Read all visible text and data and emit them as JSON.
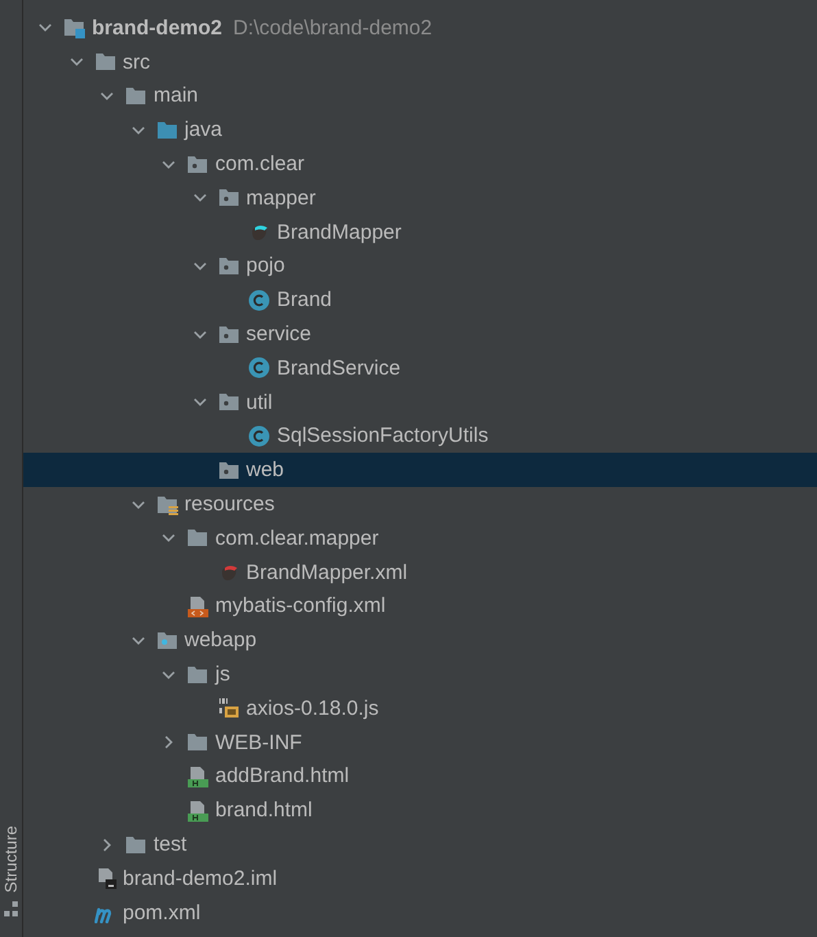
{
  "side_panel": {
    "tab": "Structure"
  },
  "tree": [
    {
      "label": "brand-demo2",
      "path": "D:\\code\\brand-demo2",
      "kind": "project",
      "expanded": true,
      "selected": false,
      "children": [
        {
          "label": "src",
          "kind": "folder",
          "expanded": true,
          "selected": false,
          "children": [
            {
              "label": "main",
              "kind": "folder",
              "expanded": true,
              "selected": false,
              "children": [
                {
                  "label": "java",
                  "kind": "source-folder",
                  "expanded": true,
                  "selected": false,
                  "children": [
                    {
                      "label": "com.clear",
                      "kind": "package",
                      "expanded": true,
                      "selected": false,
                      "children": [
                        {
                          "label": "mapper",
                          "kind": "package",
                          "expanded": true,
                          "selected": false,
                          "children": [
                            {
                              "label": "BrandMapper",
                              "kind": "mapper",
                              "selected": false
                            }
                          ]
                        },
                        {
                          "label": "pojo",
                          "kind": "package",
                          "expanded": true,
                          "selected": false,
                          "children": [
                            {
                              "label": "Brand",
                              "kind": "class",
                              "selected": false
                            }
                          ]
                        },
                        {
                          "label": "service",
                          "kind": "package",
                          "expanded": true,
                          "selected": false,
                          "children": [
                            {
                              "label": "BrandService",
                              "kind": "class",
                              "selected": false
                            }
                          ]
                        },
                        {
                          "label": "util",
                          "kind": "package",
                          "expanded": true,
                          "selected": false,
                          "children": [
                            {
                              "label": "SqlSessionFactoryUtils",
                              "kind": "class",
                              "selected": false
                            }
                          ]
                        },
                        {
                          "label": "web",
                          "kind": "package",
                          "selected": true
                        }
                      ]
                    }
                  ]
                },
                {
                  "label": "resources",
                  "kind": "resources-folder",
                  "expanded": true,
                  "selected": false,
                  "children": [
                    {
                      "label": "com.clear.mapper",
                      "kind": "folder",
                      "expanded": true,
                      "selected": false,
                      "children": [
                        {
                          "label": "BrandMapper.xml",
                          "kind": "mapper-xml",
                          "selected": false
                        }
                      ]
                    },
                    {
                      "label": "mybatis-config.xml",
                      "kind": "xml",
                      "selected": false
                    }
                  ]
                },
                {
                  "label": "webapp",
                  "kind": "web-folder",
                  "expanded": true,
                  "selected": false,
                  "children": [
                    {
                      "label": "js",
                      "kind": "folder",
                      "expanded": true,
                      "selected": false,
                      "children": [
                        {
                          "label": "axios-0.18.0.js",
                          "kind": "js",
                          "selected": false
                        }
                      ]
                    },
                    {
                      "label": "WEB-INF",
                      "kind": "folder",
                      "expanded": false,
                      "selected": false
                    },
                    {
                      "label": "addBrand.html",
                      "kind": "html",
                      "selected": false
                    },
                    {
                      "label": "brand.html",
                      "kind": "html",
                      "selected": false
                    }
                  ]
                }
              ]
            },
            {
              "label": "test",
              "kind": "folder",
              "expanded": false,
              "selected": false
            }
          ]
        },
        {
          "label": "brand-demo2.iml",
          "kind": "iml",
          "selected": false
        },
        {
          "label": "pom.xml",
          "kind": "maven",
          "selected": false
        }
      ]
    }
  ]
}
